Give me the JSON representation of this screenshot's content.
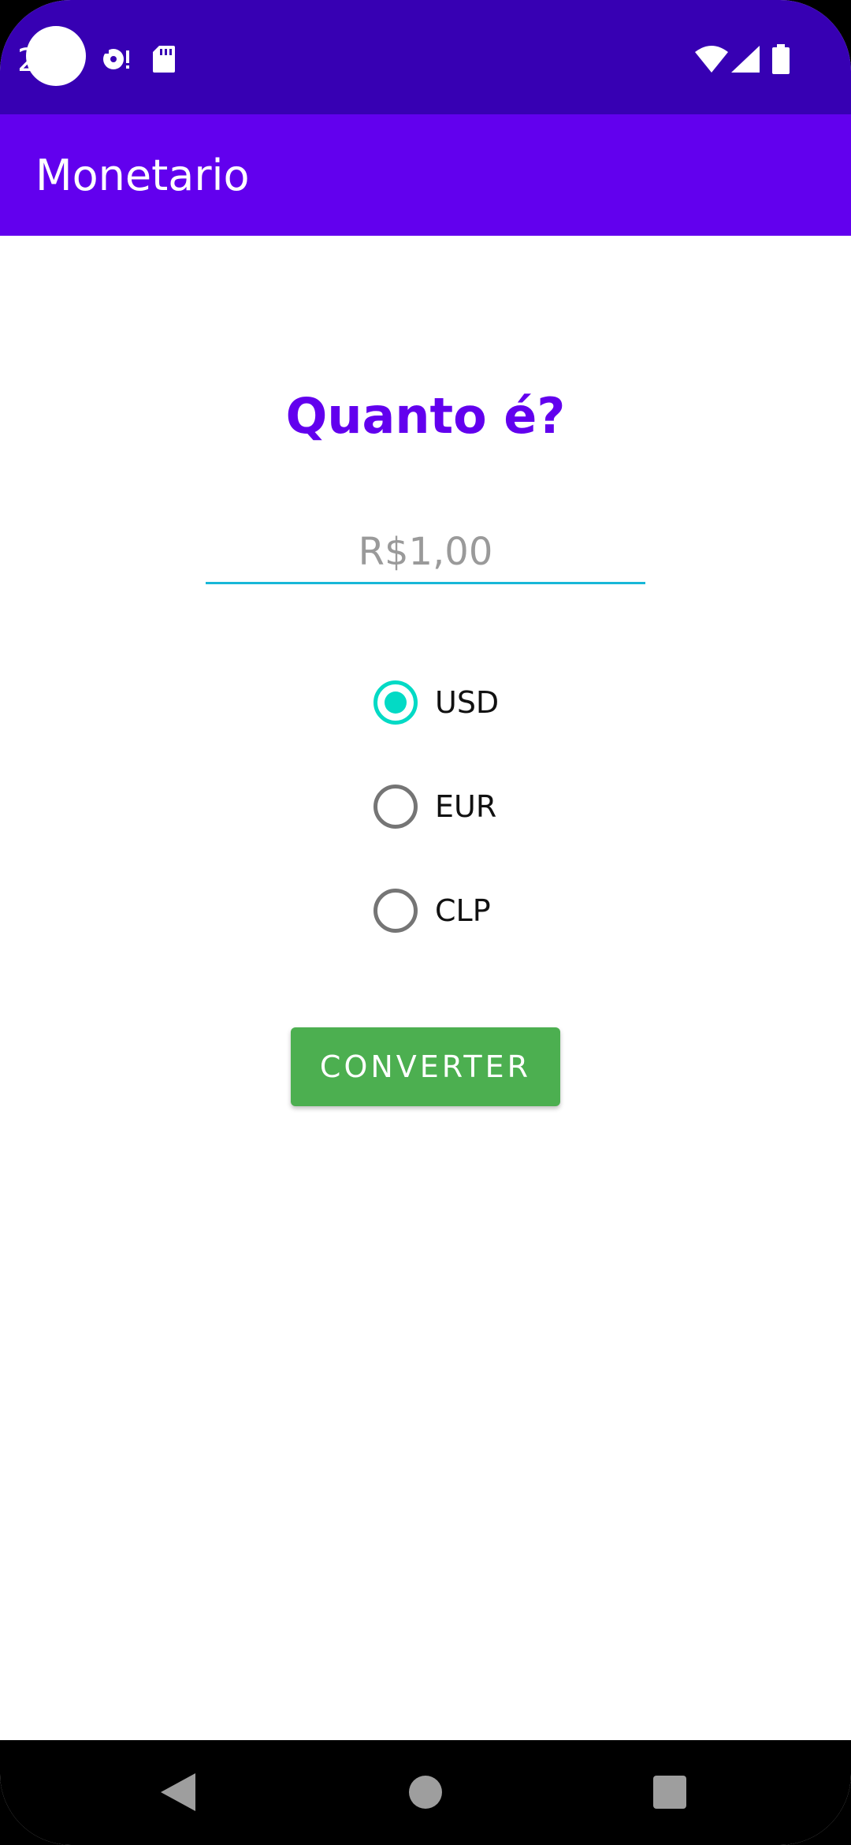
{
  "status_bar": {
    "time": "2",
    "icons": [
      "camera-cutout",
      "media-icon",
      "sd-card-icon",
      "wifi-icon",
      "signal-icon",
      "battery-icon"
    ]
  },
  "app_bar": {
    "title": "Monetario"
  },
  "main": {
    "heading": "Quanto é?",
    "amount_input": {
      "value": "",
      "placeholder": "R$1,00"
    },
    "currency_options": [
      {
        "label": "USD",
        "selected": true
      },
      {
        "label": "EUR",
        "selected": false
      },
      {
        "label": "CLP",
        "selected": false
      }
    ],
    "convert_button": "CONVERTER"
  },
  "nav_bar": {
    "icons": [
      "back-icon",
      "home-icon",
      "recents-icon"
    ]
  },
  "colors": {
    "status_bar": "#3700B3",
    "app_bar": "#6200EE",
    "accent": "#03DAC5",
    "button": "#4CAF50",
    "underline": "#18B7D8"
  }
}
